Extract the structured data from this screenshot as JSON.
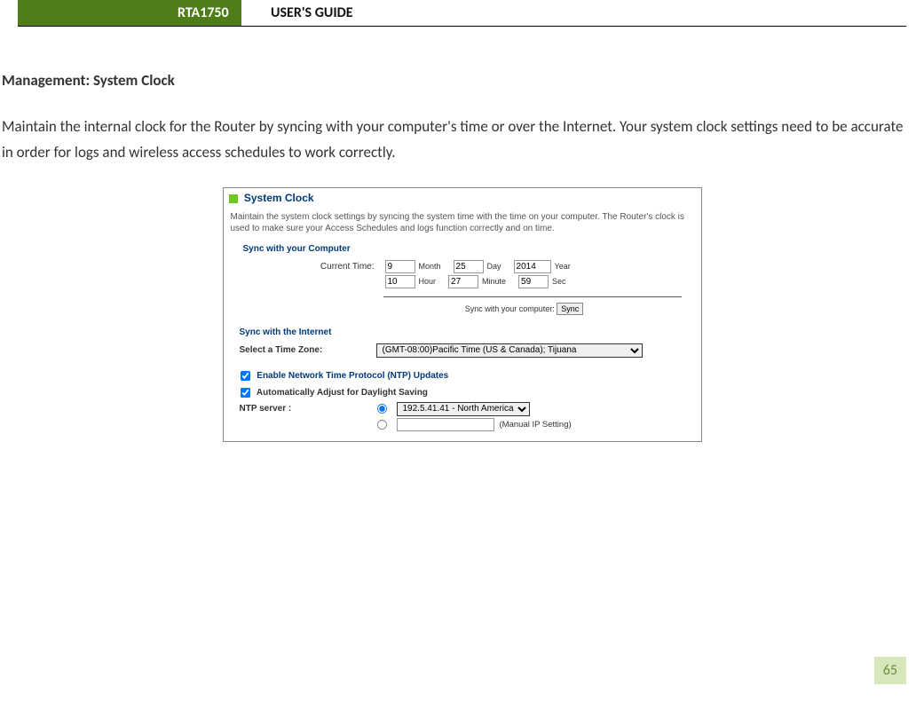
{
  "header": {
    "product": "RTA1750",
    "doc_title": "USER'S GUIDE"
  },
  "section": {
    "heading": "Management: System Clock",
    "paragraph": "Maintain the internal clock for the Router by syncing with your computer's time or over the Internet. Your system clock settings need to be accurate in order for logs and wireless access schedules to work correctly."
  },
  "panel": {
    "title": "System Clock",
    "description": "Maintain the system clock settings by syncing the system time with the time on your computer. The Router's clock is used to make sure your Access Schedules and logs function correctly and on time.",
    "sync_computer_heading": "Sync with your Computer",
    "current_time_label": "Current Time:",
    "date": {
      "month": "9",
      "month_label": "Month",
      "day": "25",
      "day_label": "Day",
      "year": "2014",
      "year_label": "Year"
    },
    "time": {
      "hour": "10",
      "hour_label": "Hour",
      "minute": "27",
      "minute_label": "Minute",
      "sec": "59",
      "sec_label": "Sec"
    },
    "sync_label": "Sync with your computer:",
    "sync_button": "Sync",
    "sync_internet_heading": "Sync with the Internet",
    "tz_label": "Select a Time Zone:",
    "tz_value": "(GMT-08:00)Pacific Time (US & Canada); Tijuana",
    "enable_ntp": "Enable Network Time Protocol (NTP) Updates",
    "dst": "Automatically Adjust for Daylight Saving",
    "ntp_server_label": "NTP server :",
    "ntp_preset": "192.5.41.41 - North America",
    "manual_label": "(Manual IP Setting)"
  },
  "page_number": "65"
}
